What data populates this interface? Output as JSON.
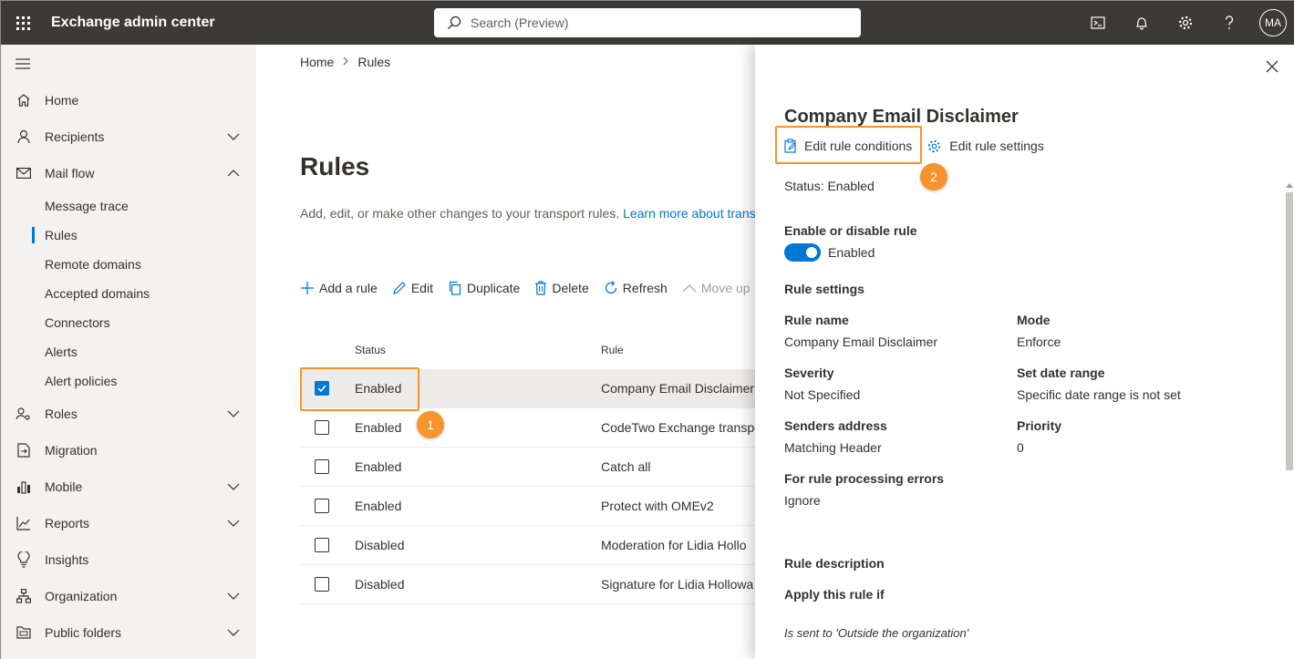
{
  "app": {
    "title": "Exchange admin center",
    "search_placeholder": "Search (Preview)",
    "avatar_initials": "MA"
  },
  "sidebar": {
    "items": [
      {
        "label": "Home",
        "icon": "home-icon"
      },
      {
        "label": "Recipients",
        "icon": "person-icon"
      },
      {
        "label": "Mail flow",
        "icon": "mail-icon"
      },
      {
        "label": "Roles",
        "icon": "roles-icon"
      },
      {
        "label": "Migration",
        "icon": "migration-icon"
      },
      {
        "label": "Mobile",
        "icon": "mobile-icon"
      },
      {
        "label": "Reports",
        "icon": "reports-icon"
      },
      {
        "label": "Insights",
        "icon": "lightbulb-icon"
      },
      {
        "label": "Organization",
        "icon": "organization-icon"
      },
      {
        "label": "Public folders",
        "icon": "folder-icon"
      }
    ],
    "mail_flow_sub": [
      "Message trace",
      "Rules",
      "Remote domains",
      "Accepted domains",
      "Connectors",
      "Alerts",
      "Alert policies"
    ],
    "active_sub": "Rules"
  },
  "main": {
    "breadcrumb": [
      "Home",
      "Rules"
    ],
    "title": "Rules",
    "description": "Add, edit, or make other changes to your transport rules.",
    "description_link": "Learn more about trans",
    "commands": [
      "Add a rule",
      "Edit",
      "Duplicate",
      "Delete",
      "Refresh",
      "Move up"
    ],
    "columns": [
      "Status",
      "Rule"
    ],
    "rows": [
      {
        "status": "Enabled",
        "rule": "Company Email Disclaimer",
        "selected": true
      },
      {
        "status": "Enabled",
        "rule": "CodeTwo Exchange transpo",
        "selected": false
      },
      {
        "status": "Enabled",
        "rule": "Catch all",
        "selected": false
      },
      {
        "status": "Enabled",
        "rule": "Protect with OMEv2",
        "selected": false
      },
      {
        "status": "Disabled",
        "rule": "Moderation for Lidia Hollo",
        "selected": false
      },
      {
        "status": "Disabled",
        "rule": "Signature for Lidia Hollowa",
        "selected": false
      }
    ]
  },
  "callouts": [
    "1",
    "2"
  ],
  "panel": {
    "title": "Company Email Disclaimer",
    "actions": [
      "Edit rule conditions",
      "Edit rule settings"
    ],
    "status": "Status: Enabled",
    "enable_label": "Enable or disable rule",
    "toggle_state": "Enabled",
    "rule_settings_heading": "Rule settings",
    "fields": [
      {
        "label": "Rule name",
        "value": "Company Email Disclaimer"
      },
      {
        "label": "Mode",
        "value": "Enforce"
      },
      {
        "label": "Severity",
        "value": "Not Specified"
      },
      {
        "label": "Set date range",
        "value": "Specific date range is not set"
      },
      {
        "label": "Senders address",
        "value": "Matching Header"
      },
      {
        "label": "Priority",
        "value": "0"
      },
      {
        "label": "For rule processing errors",
        "value": "Ignore"
      }
    ],
    "rule_description_heading": "Rule description",
    "apply_heading": "Apply this rule if",
    "condition": "Is sent to 'Outside the organization'"
  },
  "colors": {
    "accent": "#0078d4",
    "topbar": "#3b3a39",
    "callout": "#f7942d"
  }
}
